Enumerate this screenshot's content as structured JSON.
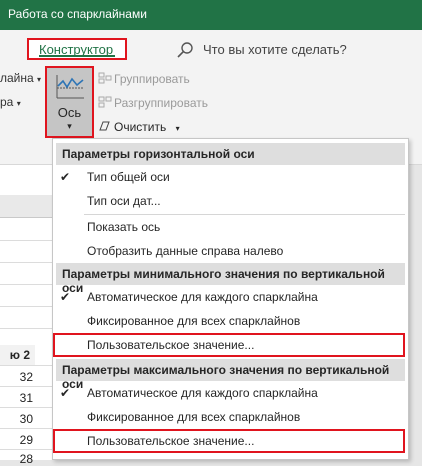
{
  "window": {
    "title": "Работа со спарклайнами"
  },
  "ribbon_tabs": {
    "active": "Конструктор",
    "search": "Что вы хотите сделать?"
  },
  "ribbon": {
    "left_fragments": [
      "лайна",
      "ра"
    ],
    "axis_button": "Ось",
    "group": "Группировать",
    "ungroup": "Разгруппировать",
    "clear": "Очистить"
  },
  "sheet": {
    "header_fragment": "ю 2",
    "values": [
      "32",
      "31",
      "30",
      "29",
      "28"
    ]
  },
  "menu": {
    "sections": [
      {
        "header": "Параметры горизонтальной оси",
        "items": [
          {
            "label": "Тип общей оси",
            "checked": true
          },
          {
            "label": "Тип оси дат...",
            "checked": false
          },
          {
            "label": "Показать ось",
            "checked": false
          },
          {
            "label": "Отобразить данные справа налево",
            "checked": false
          }
        ]
      },
      {
        "header": "Параметры минимального значения по вертикальной оси",
        "items": [
          {
            "label": "Автоматическое для каждого спарклайна",
            "checked": true
          },
          {
            "label": "Фиксированное для всех спарклайнов",
            "checked": false
          },
          {
            "label": "Пользовательское значение...",
            "checked": false,
            "highlighted": true
          }
        ]
      },
      {
        "header": "Параметры максимального значения по вертикальной оси",
        "items": [
          {
            "label": "Автоматическое для каждого спарклайна",
            "checked": true
          },
          {
            "label": "Фиксированное для всех спарклайнов",
            "checked": false
          },
          {
            "label": "Пользовательское значение...",
            "checked": false,
            "highlighted": true
          }
        ]
      }
    ]
  },
  "colors": {
    "excel_green": "#217346",
    "highlight_red": "#e0141e"
  }
}
